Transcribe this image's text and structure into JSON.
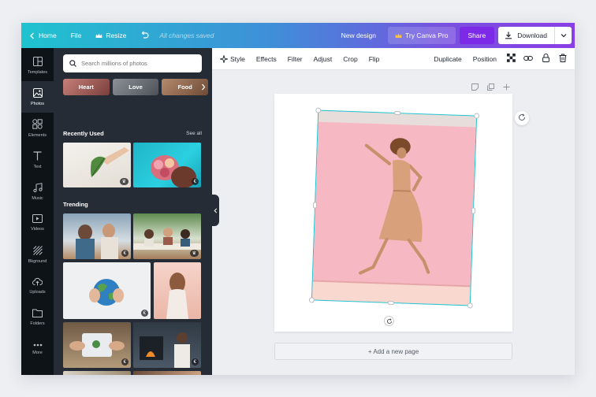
{
  "topbar": {
    "home_label": "Home",
    "file_label": "File",
    "resize_label": "Resize",
    "saved_status": "All changes saved",
    "new_design_label": "New design",
    "try_pro_label": "Try Canva Pro",
    "share_label": "Share",
    "download_label": "Download"
  },
  "rail": {
    "items": [
      {
        "label": "Templates",
        "icon": "templates-icon"
      },
      {
        "label": "Photos",
        "icon": "photos-icon"
      },
      {
        "label": "Elements",
        "icon": "elements-icon"
      },
      {
        "label": "Text",
        "icon": "text-icon"
      },
      {
        "label": "Music",
        "icon": "music-icon"
      },
      {
        "label": "Videos",
        "icon": "videos-icon"
      },
      {
        "label": "Bkground",
        "icon": "background-icon"
      },
      {
        "label": "Uploads",
        "icon": "uploads-icon"
      },
      {
        "label": "Folders",
        "icon": "folders-icon"
      },
      {
        "label": "More",
        "icon": "more-icon"
      }
    ],
    "active": "Photos"
  },
  "panel": {
    "search_placeholder": "Search millions of photos",
    "chips": [
      {
        "label": "Heart",
        "color": "#9b5a56"
      },
      {
        "label": "Love",
        "color": "#6a6f76"
      },
      {
        "label": "Food",
        "color": "#8f6a52"
      }
    ],
    "recently_used_title": "Recently Used",
    "see_all_label": "See all",
    "recent_badges": [
      "♛",
      "€"
    ],
    "trending_title": "Trending",
    "trending_badges": [
      "€",
      "♛",
      "€",
      "€",
      "€"
    ]
  },
  "editor_toolbar": {
    "style_label": "Style",
    "effects_label": "Effects",
    "filter_label": "Filter",
    "adjust_label": "Adjust",
    "crop_label": "Crop",
    "flip_label": "Flip",
    "duplicate_label": "Duplicate",
    "position_label": "Position"
  },
  "canvas": {
    "add_page_label": "+ Add a new page"
  },
  "colors": {
    "accent_teal": "#23c2cf",
    "share_purple": "#7d2ae8",
    "rail_bg": "#0e1318",
    "panel_bg": "#252c36"
  }
}
